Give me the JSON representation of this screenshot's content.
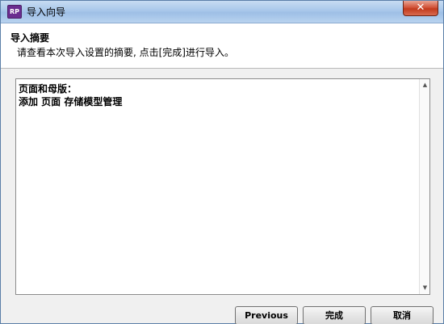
{
  "window": {
    "title": "导入向导",
    "app_icon_text": "RP",
    "close_glyph": "✕"
  },
  "header": {
    "title": "导入摘要",
    "description": "请查看本次导入设置的摘要, 点击[完成]进行导入。"
  },
  "summary": {
    "line1": "页面和母版：",
    "line2": "添加 页面 存储模型管理"
  },
  "buttons": {
    "previous": "Previous",
    "finish": "完成",
    "cancel": "取消"
  },
  "icons": {
    "scroll_up": "▲",
    "scroll_down": "▼"
  },
  "colors": {
    "app_icon": "#6a2c8f",
    "close_button": "#c23a1d",
    "titlebar": "#a8c7ea"
  }
}
